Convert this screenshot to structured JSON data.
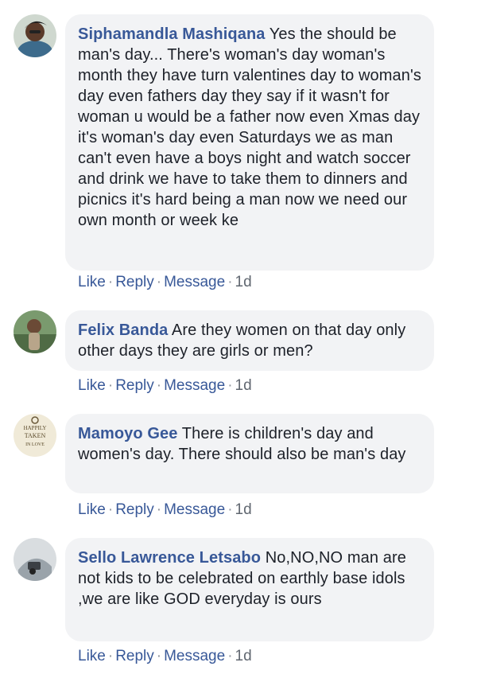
{
  "comments": [
    {
      "author": "Siphamandla Mashiqana",
      "text": "Yes the should be man's day... There's woman's day woman's month they have turn valentines day to woman's day even fathers day they say if it wasn't for woman u would be a father now even Xmas day it's woman's day even Saturdays we as man can't even have a boys night and watch soccer and drink we have to take them to dinners and picnics it's hard being a man now we need our own month or week ke",
      "like": "Like",
      "reply": "Reply",
      "message": "Message",
      "time": "1d"
    },
    {
      "author": "Felix Banda",
      "text": "Are they women on that day only other days they are girls or men?",
      "like": "Like",
      "reply": "Reply",
      "message": "Message",
      "time": "1d"
    },
    {
      "author": "Mamoyo Gee",
      "text": "There is children's day and women's day. There should also be man's day",
      "like": "Like",
      "reply": "Reply",
      "message": "Message",
      "time": "1d"
    },
    {
      "author": "Sello Lawrence Letsabo",
      "text": "No,NO,NO man are not kids to be celebrated on earthly base idols ,we are like GOD everyday is ours",
      "like": "Like",
      "reply": "Reply",
      "message": "Message",
      "time": "1d"
    }
  ],
  "avatars": {
    "c3_text": [
      "HAPPILY",
      "TAKEN",
      "IN LOVE"
    ]
  },
  "separator": "·"
}
